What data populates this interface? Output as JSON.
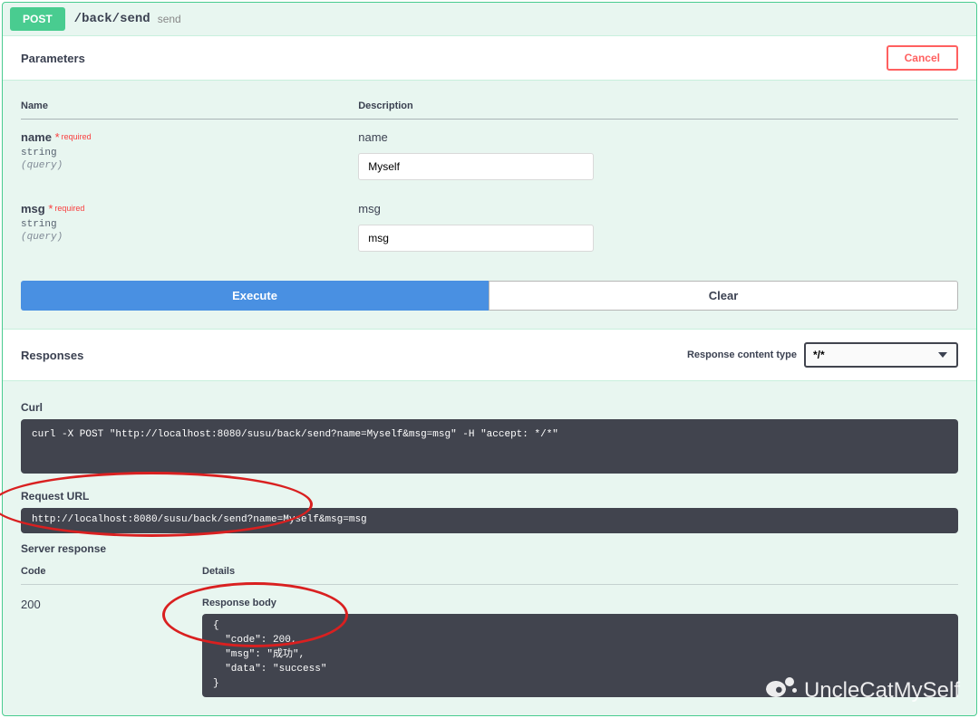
{
  "summary": {
    "method": "POST",
    "path": "/back/send",
    "desc": "send"
  },
  "sections": {
    "parameters": "Parameters",
    "responses": "Responses"
  },
  "buttons": {
    "cancel": "Cancel",
    "execute": "Execute",
    "clear": "Clear"
  },
  "table_headers": {
    "name": "Name",
    "description": "Description"
  },
  "required_label": "required",
  "params": [
    {
      "name": "name",
      "type": "string",
      "in": "(query)",
      "desc": "name",
      "value": "Myself"
    },
    {
      "name": "msg",
      "type": "string",
      "in": "(query)",
      "desc": "msg",
      "value": "msg"
    }
  ],
  "content_type": {
    "label": "Response content type",
    "value": "*/*"
  },
  "response_labels": {
    "curl": "Curl",
    "request_url": "Request URL",
    "server_response": "Server response",
    "code": "Code",
    "details": "Details",
    "response_body": "Response body"
  },
  "curl_cmd": "curl -X POST \"http://localhost:8080/susu/back/send?name=Myself&msg=msg\" -H \"accept: */*\"",
  "request_url": "http://localhost:8080/susu/back/send?name=Myself&msg=msg",
  "server": {
    "code": "200",
    "body": "{\n  \"code\": 200,\n  \"msg\": \"成功\",\n  \"data\": \"success\"\n}"
  },
  "watermark": "UncleCatMySelf"
}
